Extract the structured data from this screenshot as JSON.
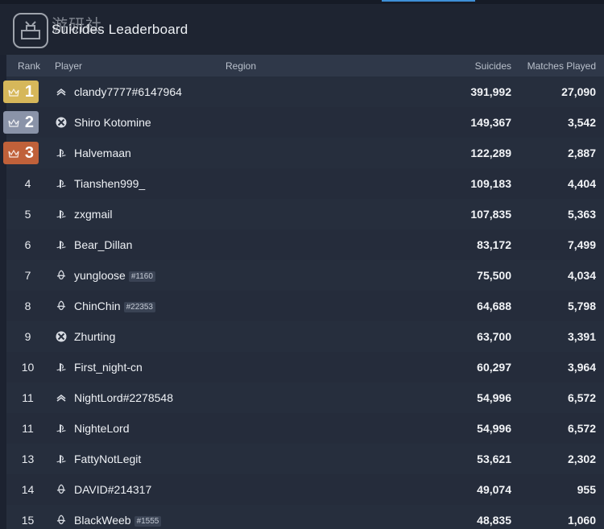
{
  "header": {
    "watermark_text": "游研社",
    "title": "Suicides Leaderboard"
  },
  "columns": {
    "rank": "Rank",
    "player": "Player",
    "region": "Region",
    "suicides": "Suicides",
    "matches": "Matches Played"
  },
  "colors": {
    "gold": "#d6b75a",
    "silver": "#8a93a8",
    "bronze": "#c0613a",
    "accent": "#3e8fd6"
  },
  "rows": [
    {
      "rank": "1",
      "platform": "steam-icon",
      "name": "clandy7777#6147964",
      "tag": "",
      "suicides": "391,992",
      "matches": "27,090",
      "medal": "gold"
    },
    {
      "rank": "2",
      "platform": "xbox-icon",
      "name": "Shiro Kotomine",
      "tag": "",
      "suicides": "149,367",
      "matches": "3,542",
      "medal": "silver"
    },
    {
      "rank": "3",
      "platform": "playstation-icon",
      "name": "Halvemaan",
      "tag": "",
      "suicides": "122,289",
      "matches": "2,887",
      "medal": "bronze"
    },
    {
      "rank": "4",
      "platform": "playstation-icon",
      "name": "Tianshen999_",
      "tag": "",
      "suicides": "109,183",
      "matches": "4,404",
      "medal": ""
    },
    {
      "rank": "5",
      "platform": "playstation-icon",
      "name": "zxgmail",
      "tag": "",
      "suicides": "107,835",
      "matches": "5,363",
      "medal": ""
    },
    {
      "rank": "6",
      "platform": "playstation-icon",
      "name": "Bear_Dillan",
      "tag": "",
      "suicides": "83,172",
      "matches": "7,499",
      "medal": ""
    },
    {
      "rank": "7",
      "platform": "battlenet-icon",
      "name": "yungloose",
      "tag": "#1160",
      "suicides": "75,500",
      "matches": "4,034",
      "medal": ""
    },
    {
      "rank": "8",
      "platform": "battlenet-icon",
      "name": "ChinChin",
      "tag": "#22353",
      "suicides": "64,688",
      "matches": "5,798",
      "medal": ""
    },
    {
      "rank": "9",
      "platform": "xbox-icon",
      "name": "Zhurting",
      "tag": "",
      "suicides": "63,700",
      "matches": "3,391",
      "medal": ""
    },
    {
      "rank": "10",
      "platform": "playstation-icon",
      "name": "First_night-cn",
      "tag": "",
      "suicides": "60,297",
      "matches": "3,964",
      "medal": ""
    },
    {
      "rank": "11",
      "platform": "steam-icon",
      "name": "NightLord#2278548",
      "tag": "",
      "suicides": "54,996",
      "matches": "6,572",
      "medal": ""
    },
    {
      "rank": "11",
      "platform": "playstation-icon",
      "name": "NighteLord",
      "tag": "",
      "suicides": "54,996",
      "matches": "6,572",
      "medal": ""
    },
    {
      "rank": "13",
      "platform": "playstation-icon",
      "name": "FattyNotLegit",
      "tag": "",
      "suicides": "53,621",
      "matches": "2,302",
      "medal": ""
    },
    {
      "rank": "14",
      "platform": "battlenet-icon",
      "name": "DAVID#214317",
      "tag": "",
      "suicides": "49,074",
      "matches": "955",
      "medal": ""
    },
    {
      "rank": "15",
      "platform": "battlenet-icon",
      "name": "BlackWeeb",
      "tag": "#1555",
      "suicides": "48,835",
      "matches": "1,060",
      "medal": ""
    }
  ]
}
